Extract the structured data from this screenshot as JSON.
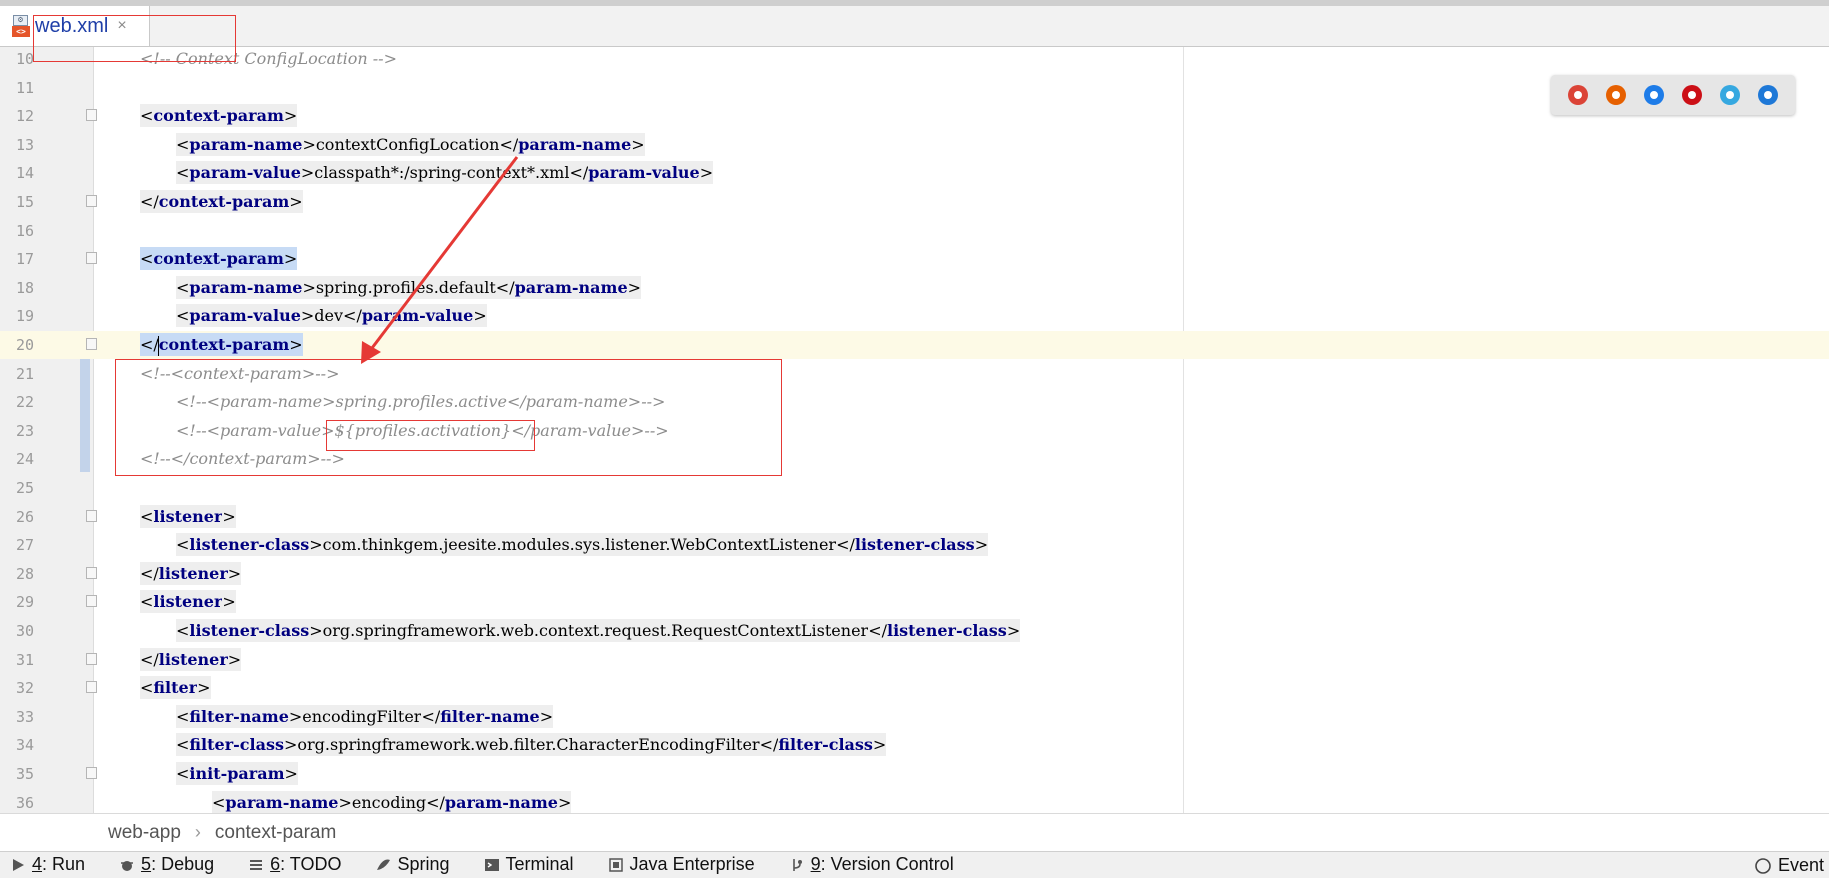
{
  "tab": {
    "title": "web.xml",
    "close_glyph": "×",
    "icon": "xml-file-icon"
  },
  "editor": {
    "lines": [
      {
        "n": "10",
        "fold": false,
        "indent": 0,
        "current": false,
        "segs": [
          {
            "t": "<!-- Context ConfigLocation -->",
            "c": "cm"
          }
        ]
      },
      {
        "n": "11",
        "fold": false,
        "indent": 0,
        "current": false,
        "segs": []
      },
      {
        "n": "12",
        "fold": true,
        "indent": 0,
        "current": false,
        "segs": [
          {
            "t": "<",
            "c": "br",
            "hl": true
          },
          {
            "t": "context-param",
            "c": "tag",
            "hl": true
          },
          {
            "t": ">",
            "c": "br",
            "hl": true
          }
        ]
      },
      {
        "n": "13",
        "fold": false,
        "indent": 1,
        "current": false,
        "segs": [
          {
            "t": "<",
            "c": "br",
            "hl": true
          },
          {
            "t": "param-name",
            "c": "tag",
            "hl": true
          },
          {
            "t": ">",
            "c": "br",
            "hl": true
          },
          {
            "t": "contextConfigLocation",
            "c": "txt",
            "hl": true
          },
          {
            "t": "</",
            "c": "br",
            "hl": true
          },
          {
            "t": "param-name",
            "c": "tag",
            "hl": true
          },
          {
            "t": ">",
            "c": "br",
            "hl": true
          }
        ]
      },
      {
        "n": "14",
        "fold": false,
        "indent": 1,
        "current": false,
        "segs": [
          {
            "t": "<",
            "c": "br",
            "hl": true
          },
          {
            "t": "param-value",
            "c": "tag",
            "hl": true
          },
          {
            "t": ">",
            "c": "br",
            "hl": true
          },
          {
            "t": "classpath*:/spring-context*.xml",
            "c": "txt",
            "hl": true
          },
          {
            "t": "</",
            "c": "br",
            "hl": true
          },
          {
            "t": "param-value",
            "c": "tag",
            "hl": true
          },
          {
            "t": ">",
            "c": "br",
            "hl": true
          }
        ]
      },
      {
        "n": "15",
        "fold": true,
        "indent": 0,
        "current": false,
        "segs": [
          {
            "t": "</",
            "c": "br",
            "hl": true
          },
          {
            "t": "context-param",
            "c": "tag",
            "hl": true
          },
          {
            "t": ">",
            "c": "br",
            "hl": true
          }
        ]
      },
      {
        "n": "16",
        "fold": false,
        "indent": 0,
        "current": false,
        "segs": []
      },
      {
        "n": "17",
        "fold": true,
        "indent": 0,
        "current": false,
        "segs": [
          {
            "t": "<",
            "c": "br",
            "sel": true
          },
          {
            "t": "context-param",
            "c": "tag",
            "sel": true
          },
          {
            "t": ">",
            "c": "br",
            "sel": true
          }
        ]
      },
      {
        "n": "18",
        "fold": false,
        "indent": 1,
        "current": false,
        "segs": [
          {
            "t": "<",
            "c": "br",
            "hl": true
          },
          {
            "t": "param-name",
            "c": "tag",
            "hl": true
          },
          {
            "t": ">",
            "c": "br",
            "hl": true
          },
          {
            "t": "spring.profiles.default",
            "c": "txt",
            "hl": true
          },
          {
            "t": "</",
            "c": "br",
            "hl": true
          },
          {
            "t": "param-name",
            "c": "tag",
            "hl": true
          },
          {
            "t": ">",
            "c": "br",
            "hl": true
          }
        ]
      },
      {
        "n": "19",
        "fold": false,
        "indent": 1,
        "current": false,
        "segs": [
          {
            "t": "<",
            "c": "br",
            "hl": true
          },
          {
            "t": "param-value",
            "c": "tag",
            "hl": true
          },
          {
            "t": ">",
            "c": "br",
            "hl": true
          },
          {
            "t": "dev",
            "c": "txt",
            "hl": true
          },
          {
            "t": "</",
            "c": "br",
            "hl": true
          },
          {
            "t": "param-value",
            "c": "tag",
            "hl": true
          },
          {
            "t": ">",
            "c": "br",
            "hl": true
          }
        ]
      },
      {
        "n": "20",
        "fold": true,
        "indent": 0,
        "current": true,
        "segs": [
          {
            "t": "</",
            "c": "br",
            "sel": true,
            "caret": true
          },
          {
            "t": "context-param",
            "c": "tag",
            "sel": true
          },
          {
            "t": ">",
            "c": "br",
            "sel": true
          }
        ]
      },
      {
        "n": "21",
        "fold": false,
        "indent": 0,
        "current": false,
        "segs": [
          {
            "t": "<!--<context-param>-->",
            "c": "cm"
          }
        ]
      },
      {
        "n": "22",
        "fold": false,
        "indent": 1,
        "current": false,
        "segs": [
          {
            "t": "<!--<param-name>spring.profiles.active</param-name>-->",
            "c": "cm"
          }
        ]
      },
      {
        "n": "23",
        "fold": false,
        "indent": 1,
        "current": false,
        "segs": [
          {
            "t": "<!--<param-value>${profiles.activation}</param-value>-->",
            "c": "cm"
          }
        ]
      },
      {
        "n": "24",
        "fold": false,
        "indent": 0,
        "current": false,
        "segs": [
          {
            "t": "<!--</context-param>-->",
            "c": "cm"
          }
        ]
      },
      {
        "n": "25",
        "fold": false,
        "indent": 0,
        "current": false,
        "segs": []
      },
      {
        "n": "26",
        "fold": true,
        "indent": 0,
        "current": false,
        "segs": [
          {
            "t": "<",
            "c": "br",
            "hl": true
          },
          {
            "t": "listener",
            "c": "tag",
            "hl": true
          },
          {
            "t": ">",
            "c": "br",
            "hl": true
          }
        ]
      },
      {
        "n": "27",
        "fold": false,
        "indent": 1,
        "current": false,
        "segs": [
          {
            "t": "<",
            "c": "br",
            "hl": true
          },
          {
            "t": "listener-class",
            "c": "tag",
            "hl": true
          },
          {
            "t": ">",
            "c": "br",
            "hl": true
          },
          {
            "t": "com.thinkgem.jeesite.modules.sys.listener.WebContextListener",
            "c": "txt",
            "hl": true
          },
          {
            "t": "</",
            "c": "br",
            "hl": true
          },
          {
            "t": "listener-class",
            "c": "tag",
            "hl": true
          },
          {
            "t": ">",
            "c": "br",
            "hl": true
          }
        ]
      },
      {
        "n": "28",
        "fold": true,
        "indent": 0,
        "current": false,
        "segs": [
          {
            "t": "</",
            "c": "br",
            "hl": true
          },
          {
            "t": "listener",
            "c": "tag",
            "hl": true
          },
          {
            "t": ">",
            "c": "br",
            "hl": true
          }
        ]
      },
      {
        "n": "29",
        "fold": true,
        "indent": 0,
        "current": false,
        "segs": [
          {
            "t": "<",
            "c": "br",
            "hl": true
          },
          {
            "t": "listener",
            "c": "tag",
            "hl": true
          },
          {
            "t": ">",
            "c": "br",
            "hl": true
          }
        ]
      },
      {
        "n": "30",
        "fold": false,
        "indent": 1,
        "current": false,
        "segs": [
          {
            "t": "<",
            "c": "br",
            "hl": true
          },
          {
            "t": "listener-class",
            "c": "tag",
            "hl": true
          },
          {
            "t": ">",
            "c": "br",
            "hl": true
          },
          {
            "t": "org.springframework.web.context.request.RequestContextListener",
            "c": "txt",
            "hl": true
          },
          {
            "t": "</",
            "c": "br",
            "hl": true
          },
          {
            "t": "listener-class",
            "c": "tag",
            "hl": true
          },
          {
            "t": ">",
            "c": "br",
            "hl": true
          }
        ]
      },
      {
        "n": "31",
        "fold": true,
        "indent": 0,
        "current": false,
        "segs": [
          {
            "t": "</",
            "c": "br",
            "hl": true
          },
          {
            "t": "listener",
            "c": "tag",
            "hl": true
          },
          {
            "t": ">",
            "c": "br",
            "hl": true
          }
        ]
      },
      {
        "n": "32",
        "fold": true,
        "indent": 0,
        "current": false,
        "segs": [
          {
            "t": "<",
            "c": "br",
            "hl": true
          },
          {
            "t": "filter",
            "c": "tag",
            "hl": true
          },
          {
            "t": ">",
            "c": "br",
            "hl": true
          }
        ]
      },
      {
        "n": "33",
        "fold": false,
        "indent": 1,
        "current": false,
        "segs": [
          {
            "t": "<",
            "c": "br",
            "hl": true
          },
          {
            "t": "filter-name",
            "c": "tag",
            "hl": true
          },
          {
            "t": ">",
            "c": "br",
            "hl": true
          },
          {
            "t": "encodingFilter",
            "c": "txt",
            "hl": true
          },
          {
            "t": "</",
            "c": "br",
            "hl": true
          },
          {
            "t": "filter-name",
            "c": "tag",
            "hl": true
          },
          {
            "t": ">",
            "c": "br",
            "hl": true
          }
        ]
      },
      {
        "n": "34",
        "fold": false,
        "indent": 1,
        "current": false,
        "segs": [
          {
            "t": "<",
            "c": "br",
            "hl": true
          },
          {
            "t": "filter-class",
            "c": "tag",
            "hl": true
          },
          {
            "t": ">",
            "c": "br",
            "hl": true
          },
          {
            "t": "org.springframework.web.filter.CharacterEncodingFilter",
            "c": "txt",
            "hl": true
          },
          {
            "t": "</",
            "c": "br",
            "hl": true
          },
          {
            "t": "filter-class",
            "c": "tag",
            "hl": true
          },
          {
            "t": ">",
            "c": "br",
            "hl": true
          }
        ]
      },
      {
        "n": "35",
        "fold": true,
        "indent": 1,
        "current": false,
        "segs": [
          {
            "t": "<",
            "c": "br",
            "hl": true
          },
          {
            "t": "init-param",
            "c": "tag",
            "hl": true
          },
          {
            "t": ">",
            "c": "br",
            "hl": true
          }
        ]
      },
      {
        "n": "36",
        "fold": false,
        "indent": 2,
        "current": false,
        "segs": [
          {
            "t": "<",
            "c": "br",
            "hl": true
          },
          {
            "t": "param-name",
            "c": "tag",
            "hl": true
          },
          {
            "t": ">",
            "c": "br",
            "hl": true
          },
          {
            "t": "encoding",
            "c": "txt",
            "hl": true
          },
          {
            "t": "</",
            "c": "br",
            "hl": true
          },
          {
            "t": "param-name",
            "c": "tag",
            "hl": true
          },
          {
            "t": ">",
            "c": "br",
            "hl": true
          }
        ]
      }
    ]
  },
  "browsers": [
    {
      "name": "chrome-icon",
      "color": "#db4437"
    },
    {
      "name": "firefox-icon",
      "color": "#e66000"
    },
    {
      "name": "safari-icon",
      "color": "#1e7ce8"
    },
    {
      "name": "opera-icon",
      "color": "#cc0f16"
    },
    {
      "name": "ie-icon",
      "color": "#36a8e0"
    },
    {
      "name": "edge-icon",
      "color": "#1e78d7"
    }
  ],
  "breadcrumb": {
    "items": [
      "web-app",
      "context-param"
    ],
    "separator": "›"
  },
  "toolbar": {
    "items": [
      {
        "key": "4",
        "label": ": Run",
        "icon": "run-icon"
      },
      {
        "key": "5",
        "label": ": Debug",
        "icon": "debug-icon"
      },
      {
        "key": "6",
        "label": ": TODO",
        "icon": "todo-icon"
      },
      {
        "key": "",
        "label": "Spring",
        "icon": "spring-icon"
      },
      {
        "key": "",
        "label": "Terminal",
        "icon": "terminal-icon"
      },
      {
        "key": "",
        "label": "Java Enterprise",
        "icon": "java-enterprise-icon"
      },
      {
        "key": "9",
        "label": ": Version Control",
        "icon": "version-control-icon"
      }
    ],
    "event_log": "Event Lo"
  },
  "colors": {
    "annotation": "#e53935",
    "tag": "#000080",
    "comment": "#8c8c8c",
    "selection": "#c7dbf5",
    "current_line": "#fdfae6"
  }
}
